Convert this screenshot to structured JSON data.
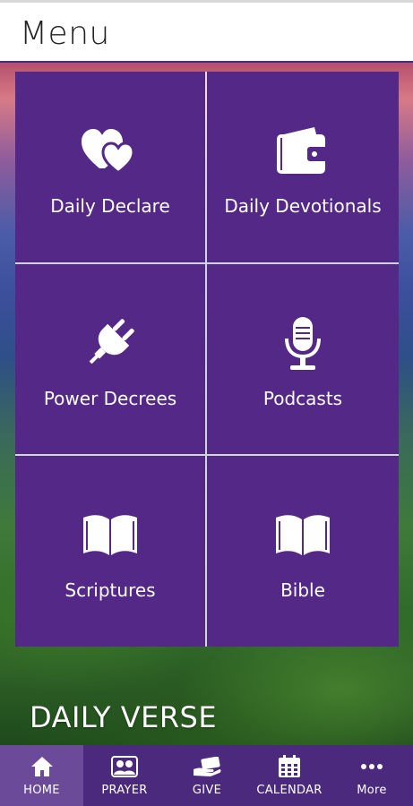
{
  "header": {
    "title": "Menu"
  },
  "tiles": [
    {
      "label": "Daily Declare",
      "icon": "hearts-icon"
    },
    {
      "label": "Daily Devotionals",
      "icon": "wallet-icon"
    },
    {
      "label": "Power Decrees",
      "icon": "plug-icon"
    },
    {
      "label": "Podcasts",
      "icon": "microphone-icon"
    },
    {
      "label": "Scriptures",
      "icon": "open-book-icon"
    },
    {
      "label": "Bible",
      "icon": "open-book-icon"
    }
  ],
  "banner": {
    "text": "DAILY VERSE"
  },
  "tabbar": {
    "items": [
      {
        "label": "HOME",
        "icon": "home-icon",
        "active": true
      },
      {
        "label": "PRAYER",
        "icon": "people-icon",
        "active": false
      },
      {
        "label": "GIVE",
        "icon": "give-icon",
        "active": false
      },
      {
        "label": "CALENDAR",
        "icon": "calendar-icon",
        "active": false
      },
      {
        "label": "More",
        "icon": "more-dots-icon",
        "active": false
      }
    ]
  },
  "colors": {
    "tile": "#532886",
    "tabbar": "#4b2a7d",
    "tab_active": "#6b4a99"
  }
}
